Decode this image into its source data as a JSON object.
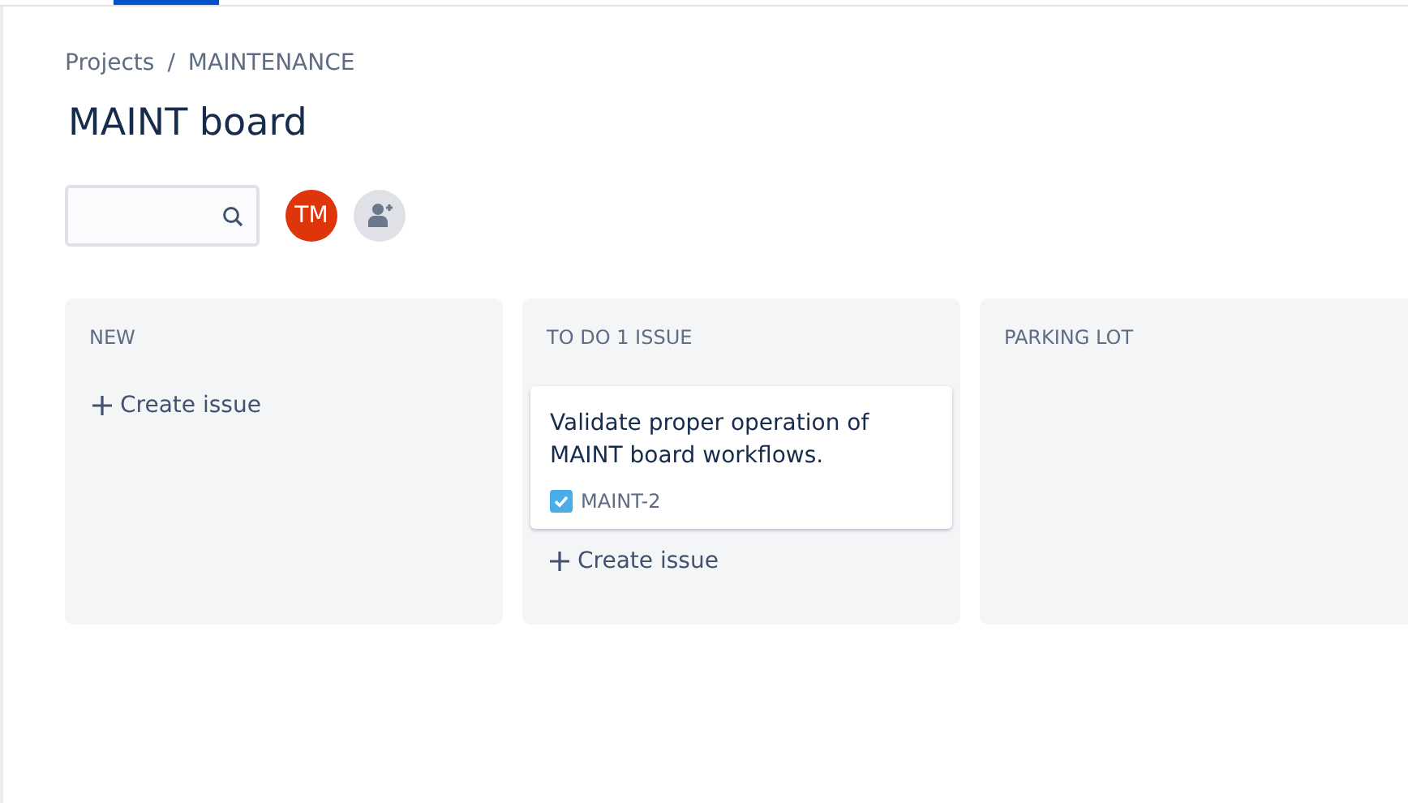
{
  "breadcrumbs": [
    "Projects",
    "MAINTENANCE"
  ],
  "breadcrumb_separator": "/",
  "title": "MAINT board",
  "avatars": [
    {
      "kind": "initials",
      "text": "TM",
      "color": "#de350b"
    },
    {
      "kind": "add-person"
    }
  ],
  "columns": [
    {
      "header": "NEW",
      "create_label": "Create issue"
    },
    {
      "header": "TO DO 1 ISSUE",
      "issues": [
        {
          "summary": "Validate proper operation of MAINT board workflows.",
          "key": "MAINT-2"
        }
      ],
      "create_label": "Create issue"
    },
    {
      "header": "PARKING LOT"
    }
  ]
}
